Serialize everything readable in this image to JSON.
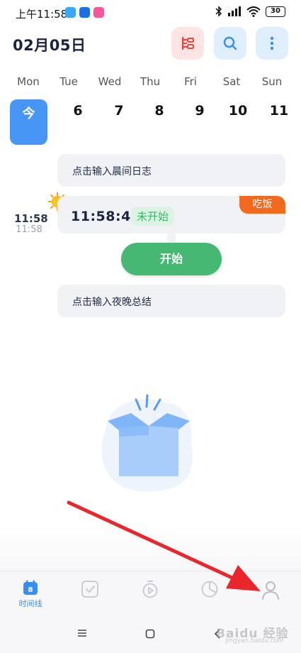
{
  "status_bar": {
    "time": "上午11:58",
    "battery": "30"
  },
  "header": {
    "date": "02月05日",
    "icons": [
      "filter-icon",
      "search-icon",
      "more-icon"
    ]
  },
  "week": {
    "days": [
      {
        "label": "Mon",
        "num": "今"
      },
      {
        "label": "Tue",
        "num": "6"
      },
      {
        "label": "Wed",
        "num": "7"
      },
      {
        "label": "Thu",
        "num": "8"
      },
      {
        "label": "Fri",
        "num": "9"
      },
      {
        "label": "Sat",
        "num": "10"
      },
      {
        "label": "Sun",
        "num": "11"
      }
    ]
  },
  "timeline": {
    "morning_log": "点击输入晨间日志",
    "event": {
      "start_time": "11:58",
      "end_time": "11:58",
      "countdown": "11:58:47",
      "status": "未开始",
      "tag": "吃饭",
      "start_button": "开始"
    },
    "evening_summary": "点击输入夜晚总结"
  },
  "tabbar": {
    "timeline_label": "时间线",
    "calendar_badge": "8",
    "icons": [
      "calendar-icon",
      "checkbox-icon",
      "timer-icon",
      "pie-chart-icon",
      "user-icon"
    ]
  },
  "watermark": {
    "text": "Baidu 经验",
    "sub": "jingyan.baidu.com"
  },
  "colors": {
    "accent_blue": "#4796f5",
    "start_green": "#46b873",
    "tag_orange": "#f36a1f",
    "annotation_red": "#e8262b"
  }
}
